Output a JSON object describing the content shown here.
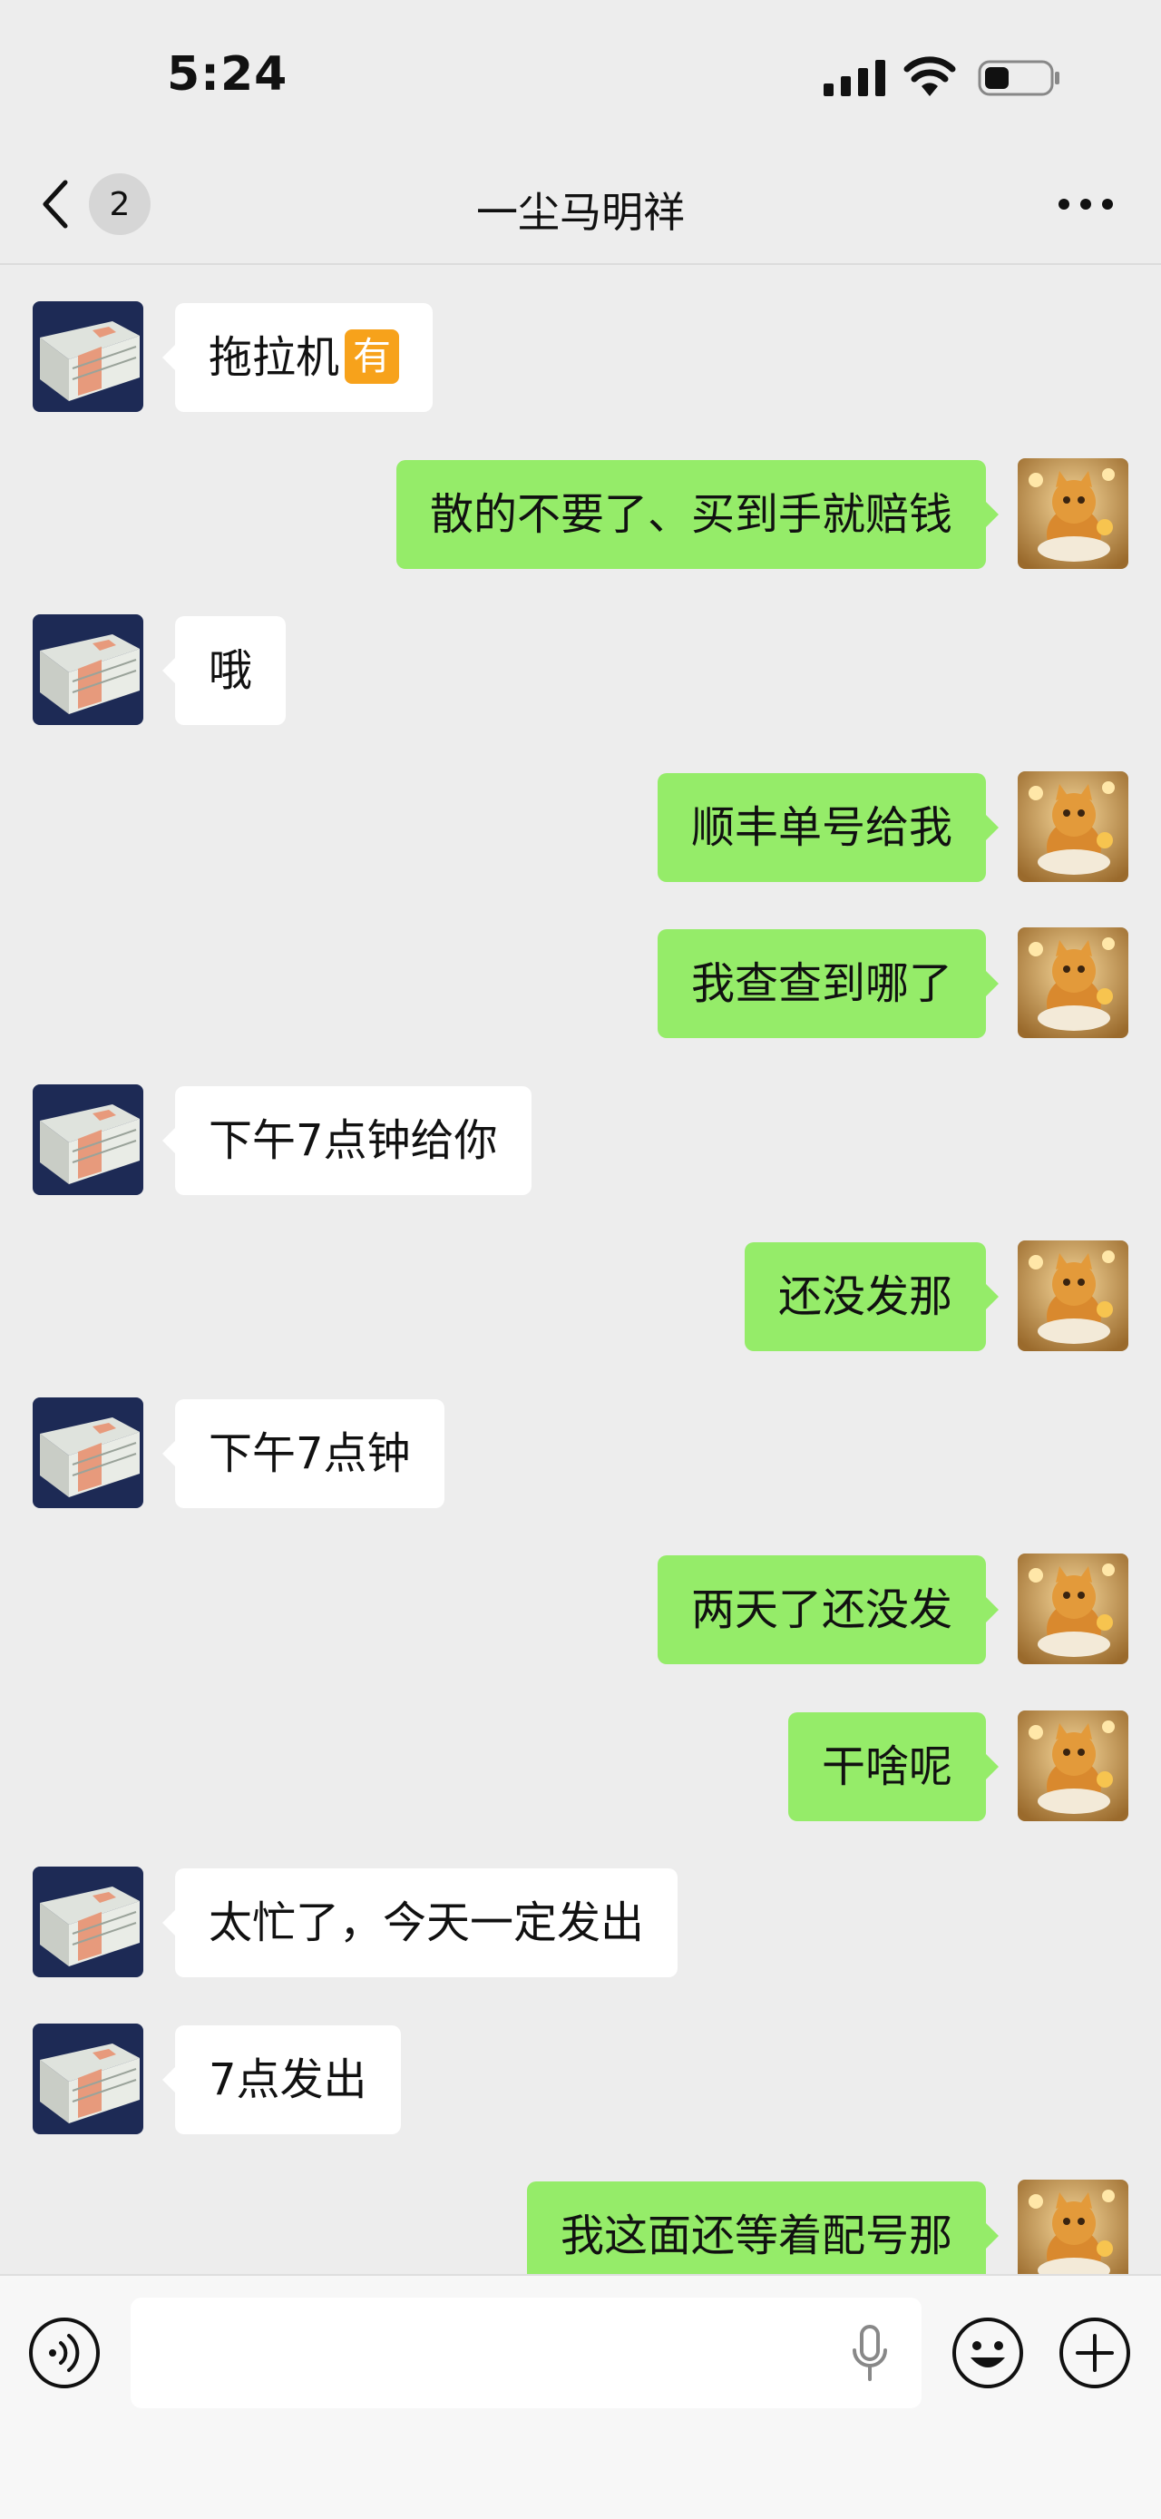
{
  "status_bar": {
    "time": "5:24",
    "icons": [
      "signal-icon",
      "wifi-icon",
      "battery-icon"
    ]
  },
  "nav": {
    "back_icon": "chevron-left-icon",
    "unread_count": "2",
    "title": "一尘马明祥",
    "more_icon": "more-dots-icon"
  },
  "messages": [
    {
      "side": "in",
      "text": "拖拉机",
      "emoji": "有"
    },
    {
      "side": "out",
      "text": "散的不要了、买到手就赔钱"
    },
    {
      "side": "in",
      "text": "哦"
    },
    {
      "side": "out",
      "text": "顺丰单号给我"
    },
    {
      "side": "out",
      "text": "我查查到哪了"
    },
    {
      "side": "in",
      "text": "下午7点钟给你"
    },
    {
      "side": "out",
      "text": "还没发那"
    },
    {
      "side": "in",
      "text": "下午7点钟"
    },
    {
      "side": "out",
      "text": "两天了还没发"
    },
    {
      "side": "out",
      "text": "干啥呢"
    },
    {
      "side": "in",
      "text": "太忙了，今天一定发出"
    },
    {
      "side": "in",
      "text": "7点发出"
    },
    {
      "side": "out",
      "text": "我这面还等着配号那"
    }
  ],
  "input_bar": {
    "icons": [
      "voice-icon",
      "microphone-icon",
      "emoji-icon",
      "plus-icon"
    ],
    "text_value": ""
  },
  "colors": {
    "background": "#ededed",
    "incoming_bubble": "#ffffff",
    "outgoing_bubble": "#95ec69",
    "emoji_badge": "#f7a21b"
  }
}
